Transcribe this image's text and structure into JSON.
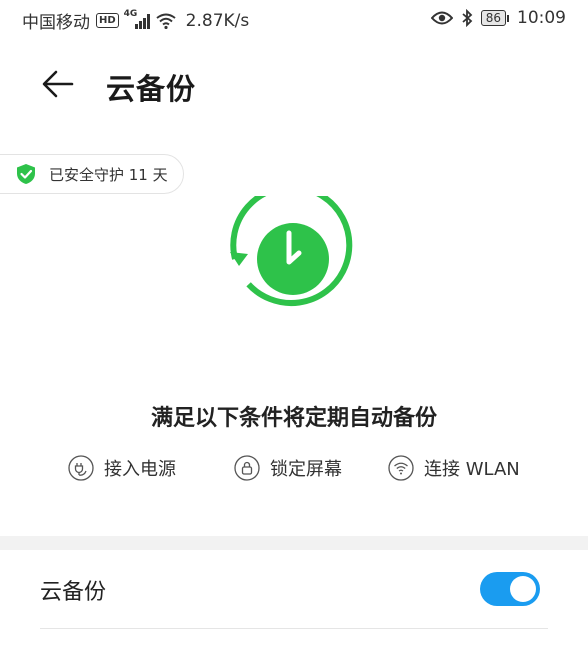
{
  "status_bar": {
    "carrier": "中国移动",
    "hd_label": "HD",
    "network_label": "4G",
    "speed": "2.87K/s",
    "battery_level": "86",
    "time": "10:09",
    "icons": [
      "signal-icon",
      "wifi-icon",
      "eye-icon",
      "bluetooth-icon",
      "battery-icon"
    ]
  },
  "header": {
    "back_icon": "back-arrow-icon",
    "title": "云备份"
  },
  "protection_badge": {
    "icon": "shield-check-icon",
    "text": "已安全守护 11 天"
  },
  "hero": {
    "icon": "auto-backup-clock-icon",
    "color": "#2ec24a"
  },
  "conditions": {
    "title": "满足以下条件将定期自动备份",
    "items": [
      {
        "icon": "power-plug-icon",
        "label": "接入电源"
      },
      {
        "icon": "lock-icon",
        "label": "锁定屏幕"
      },
      {
        "icon": "wifi-icon",
        "label": "连接 WLAN"
      }
    ]
  },
  "settings": {
    "cloud_backup_label": "云备份",
    "cloud_backup_enabled": true,
    "toggle_color": "#1a9cf0"
  }
}
